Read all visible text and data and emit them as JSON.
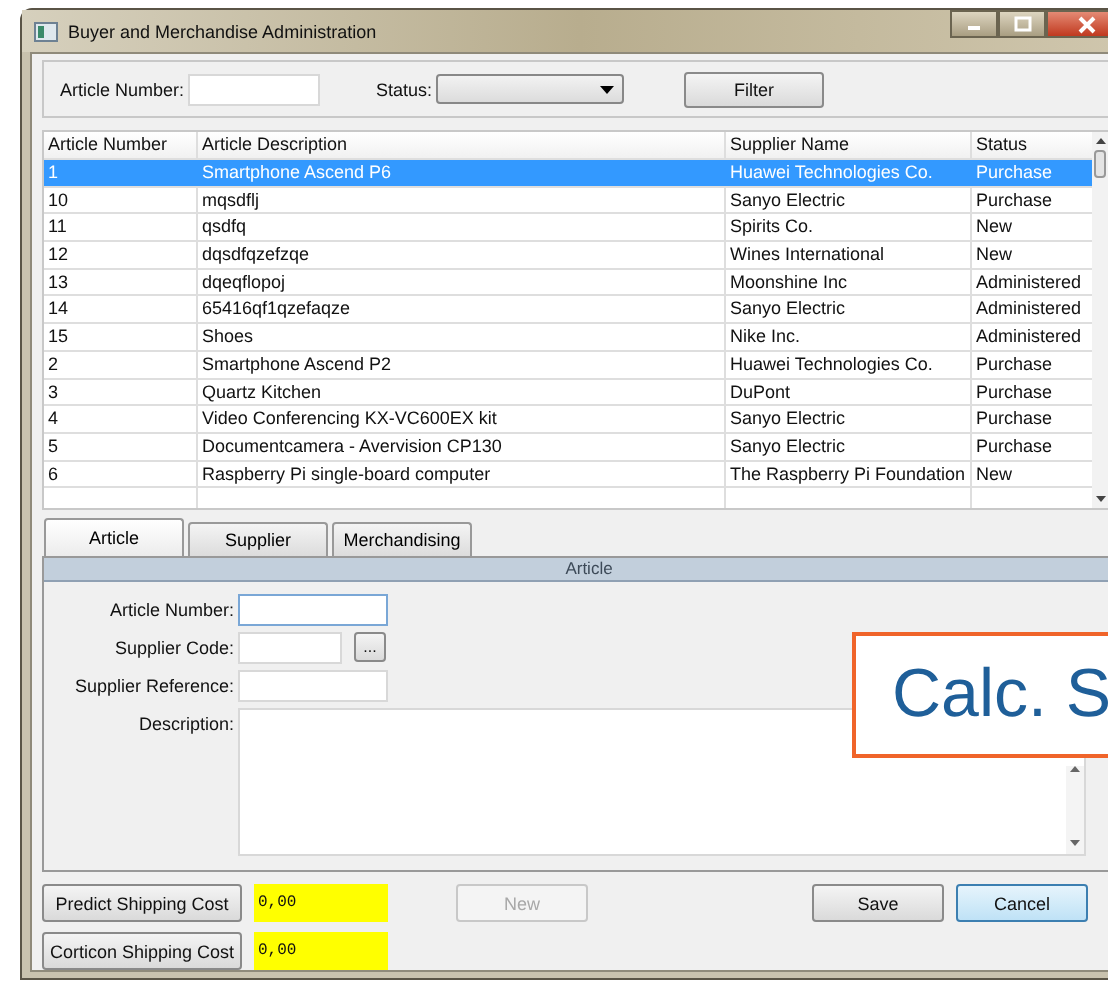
{
  "window": {
    "title": "Buyer and Merchandise Administration"
  },
  "filter": {
    "article_number_label": "Article Number:",
    "status_label": "Status:",
    "filter_button": "Filter"
  },
  "table": {
    "columns": [
      "Article Number",
      "Article Description",
      "Supplier Name",
      "Status"
    ],
    "rows": [
      {
        "cells": [
          "1",
          "Smartphone Ascend P6",
          "Huawei Technologies Co.",
          "Purchase"
        ],
        "selected": true
      },
      {
        "cells": [
          "10",
          "mqsdflj",
          "Sanyo Electric",
          "Purchase"
        ],
        "selected": false
      },
      {
        "cells": [
          "11",
          "qsdfq",
          "Spirits Co.",
          "New"
        ],
        "selected": false
      },
      {
        "cells": [
          "12",
          "dqsdfqzefzqe",
          "Wines International",
          "New"
        ],
        "selected": false
      },
      {
        "cells": [
          "13",
          "dqeqflopoj",
          "Moonshine Inc",
          "Administered"
        ],
        "selected": false
      },
      {
        "cells": [
          "14",
          "65416qf1qzefaqze",
          "Sanyo Electric",
          "Administered"
        ],
        "selected": false
      },
      {
        "cells": [
          "15",
          "Shoes",
          "Nike Inc.",
          "Administered"
        ],
        "selected": false
      },
      {
        "cells": [
          "2",
          "Smartphone Ascend P2",
          "Huawei Technologies Co.",
          "Purchase"
        ],
        "selected": false
      },
      {
        "cells": [
          "3",
          "Quartz Kitchen",
          "DuPont",
          "Purchase"
        ],
        "selected": false
      },
      {
        "cells": [
          "4",
          "Video Conferencing KX-VC600EX kit",
          "Sanyo Electric",
          "Purchase"
        ],
        "selected": false
      },
      {
        "cells": [
          "5",
          "Documentcamera - Avervision CP130",
          "Sanyo Electric",
          "Purchase"
        ],
        "selected": false
      },
      {
        "cells": [
          "6",
          "Raspberry Pi single-board computer",
          "The Raspberry Pi Foundation",
          "New"
        ],
        "selected": false
      }
    ]
  },
  "tabs": [
    {
      "label": "Article",
      "selected": true
    },
    {
      "label": "Supplier",
      "selected": false
    },
    {
      "label": "Merchandising",
      "selected": false
    }
  ],
  "panel": {
    "header": "Article",
    "fields": [
      {
        "label": "Article Number:",
        "kind": "text"
      },
      {
        "label": "Supplier Code:",
        "kind": "lookup",
        "button": "..."
      },
      {
        "label": "Supplier Reference:",
        "kind": "text"
      },
      {
        "label": "Description:",
        "kind": "memo"
      }
    ]
  },
  "overlay": {
    "text": "Calc. S"
  },
  "costs": [
    {
      "button": "Predict Shipping Cost",
      "value": "0,00"
    },
    {
      "button": "Corticon Shipping Cost",
      "value": "0,00"
    }
  ],
  "actions": [
    {
      "label": "New",
      "disabled": true,
      "default": false
    },
    {
      "label": "Save",
      "disabled": false,
      "default": false
    },
    {
      "label": "Cancel",
      "disabled": false,
      "default": true
    }
  ]
}
